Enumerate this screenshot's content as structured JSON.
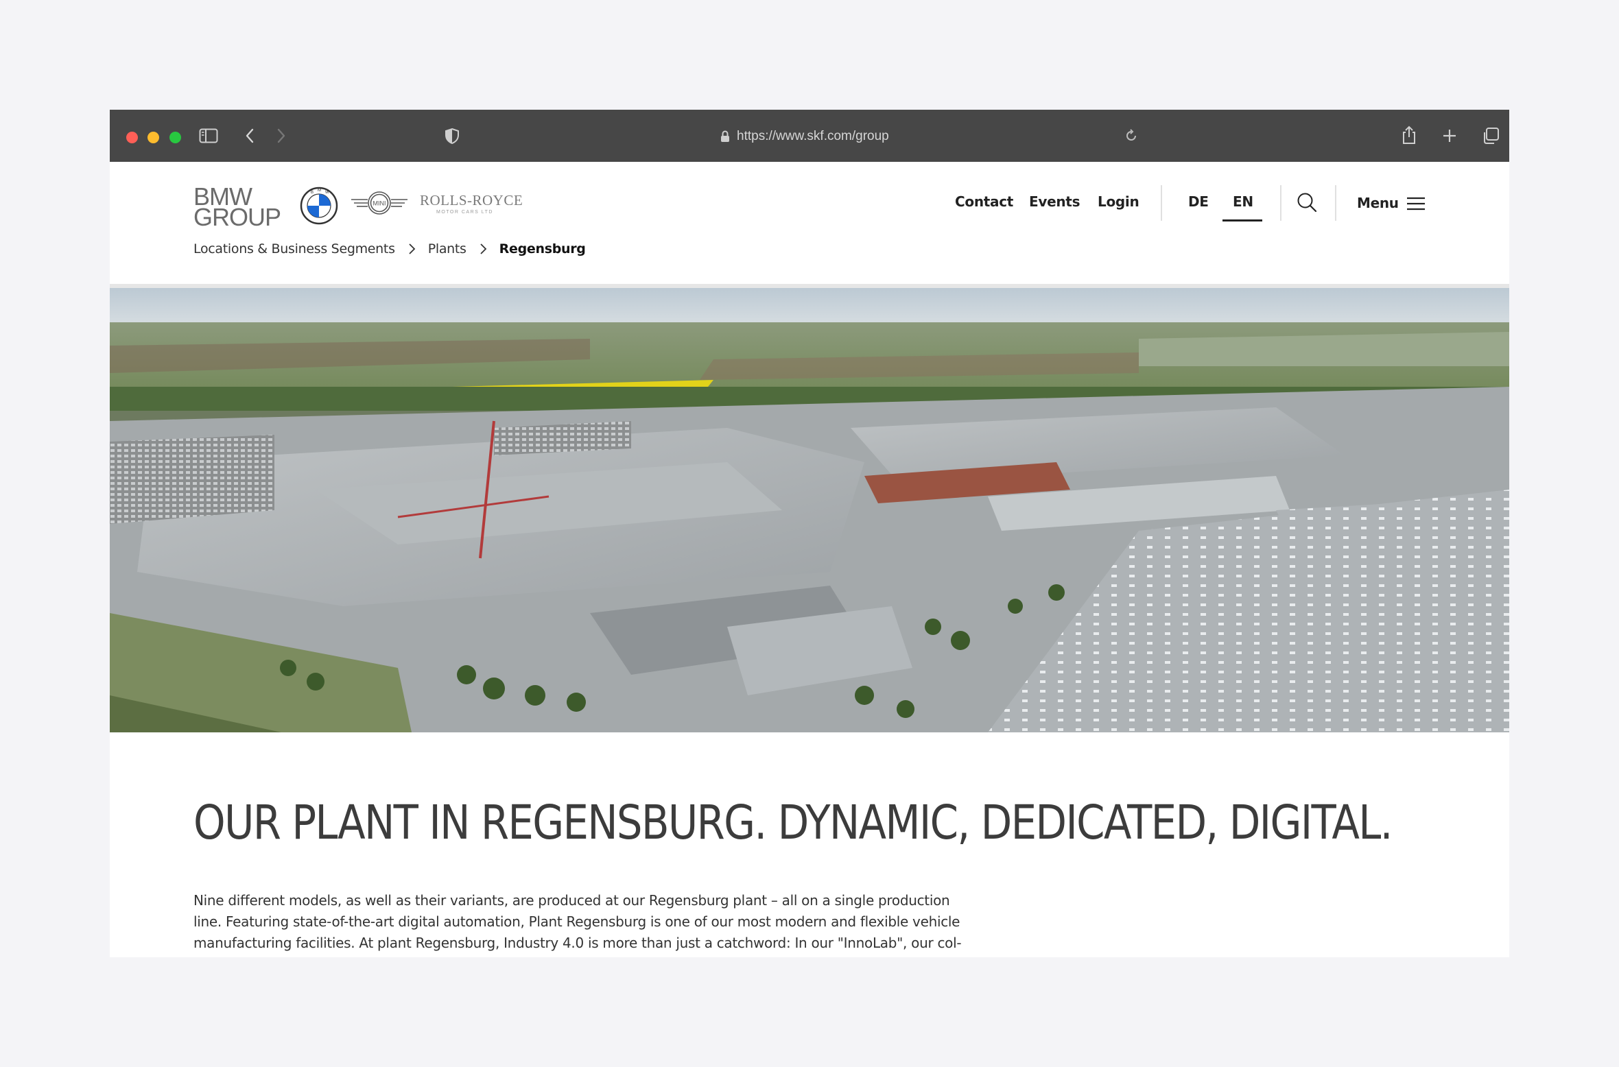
{
  "browser": {
    "url": "https://www.skf.com/group",
    "icons": [
      "sidebar-icon",
      "back-icon",
      "forward-icon",
      "shield-icon",
      "lock-icon",
      "reload-icon",
      "share-icon",
      "new-tab-icon",
      "tabs-overview-icon"
    ]
  },
  "header": {
    "brand_line1": "BMW",
    "brand_line2": "GROUP",
    "mini_label": "MINI",
    "rolls_royce_label": "ROLLS-ROYCE",
    "rolls_royce_sub": "MOTOR CARS LTD",
    "nav": {
      "contact": "Contact",
      "events": "Events",
      "login": "Login",
      "lang_de": "DE",
      "lang_en": "EN",
      "menu": "Menu"
    }
  },
  "breadcrumb": {
    "items": [
      "Locations & Business Segments",
      "Plants"
    ],
    "current": "Regensburg"
  },
  "content": {
    "headline": "OUR PLANT IN REGENSBURG. DYNAMIC, DEDICATED, DIGITAL.",
    "body_line1": "Nine different models, as well as their  variants, are produced at our Regensburg plant – all on a single production",
    "body_line2": "line. Featuring state-of-the-art digital automation, Plant Regensburg is one of our most modern and flexible vehicle",
    "body_line3": "manufacturing facilities. At plant Regensburg,  Industry 4.0 is more than just a catchword: In our \"InnoLab\", our col-"
  },
  "colors": {
    "toolbar": "#474747",
    "accent_underline": "#222222",
    "headline": "#3c3c3c"
  }
}
